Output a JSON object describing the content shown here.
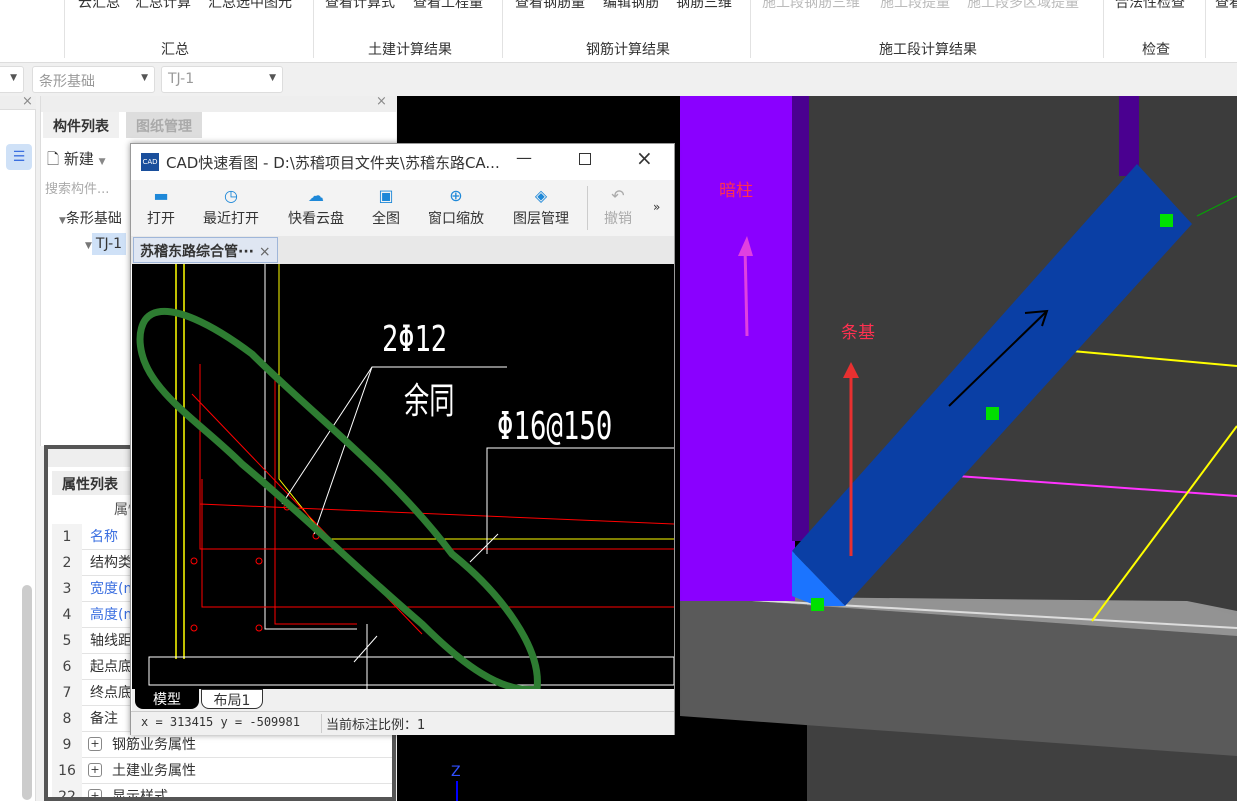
{
  "ribbon": {
    "top_items": [
      "云汇总",
      "汇总计算",
      "汇总选中图元",
      "查看计算式",
      "查看工程量",
      "查看钢筋量",
      "编辑钢筋",
      "钢筋三维",
      "施工段钢筋三维",
      "施工段提量",
      "施工段多区域提量",
      "合法性检查",
      "查看"
    ],
    "groups": [
      "汇总",
      "土建计算结果",
      "钢筋计算结果",
      "施工段计算结果",
      "检查"
    ]
  },
  "toolbar": {
    "dropdown1": "条形基础",
    "dropdown2": "TJ-1"
  },
  "panel": {
    "tabs": [
      "构件列表",
      "图纸管理"
    ],
    "new_label": "新建",
    "search_placeholder": "搜索构件...",
    "tree": [
      "条形基础",
      "TJ-1"
    ]
  },
  "props": {
    "title": "属性列表",
    "header": "属性",
    "rows": [
      {
        "n": "1",
        "l": "名称",
        "blue": true
      },
      {
        "n": "2",
        "l": "结构类别"
      },
      {
        "n": "3",
        "l": "宽度(mm)",
        "blue": true
      },
      {
        "n": "4",
        "l": "高度(mm)",
        "blue": true
      },
      {
        "n": "5",
        "l": "轴线距左"
      },
      {
        "n": "6",
        "l": "起点底标"
      },
      {
        "n": "7",
        "l": "终点底标"
      },
      {
        "n": "8",
        "l": "备注"
      },
      {
        "n": "9",
        "l": "钢筋业务属性",
        "plus": true
      },
      {
        "n": "16",
        "l": "土建业务属性",
        "plus": true
      },
      {
        "n": "22",
        "l": "显示样式",
        "plus": true
      }
    ]
  },
  "cad": {
    "title": "CAD快速看图 - D:\\苏稽项目文件夹\\苏稽东路CA...",
    "buttons": [
      {
        "label": "打开",
        "icon": "folder-icon"
      },
      {
        "label": "最近打开",
        "icon": "history-icon"
      },
      {
        "label": "快看云盘",
        "icon": "cloud-icon"
      },
      {
        "label": "全图",
        "icon": "fit-all-icon"
      },
      {
        "label": "窗口缩放",
        "icon": "zoom-window-icon"
      },
      {
        "label": "图层管理",
        "icon": "layers-icon"
      },
      {
        "label": "撤销",
        "icon": "undo-icon"
      }
    ],
    "doc_tab": "苏稽东路综合管···",
    "drawing_text": {
      "t1": "2Φ12",
      "t2": "余同",
      "t3": "Φ16@150"
    },
    "layout_tabs": [
      "模型",
      "布局1"
    ],
    "coords": "x = 313415 y = -509981",
    "scale": "当前标注比例：1"
  },
  "view3d": {
    "label_column": "暗柱",
    "label_footing": "条基",
    "axis_z": "Z"
  }
}
